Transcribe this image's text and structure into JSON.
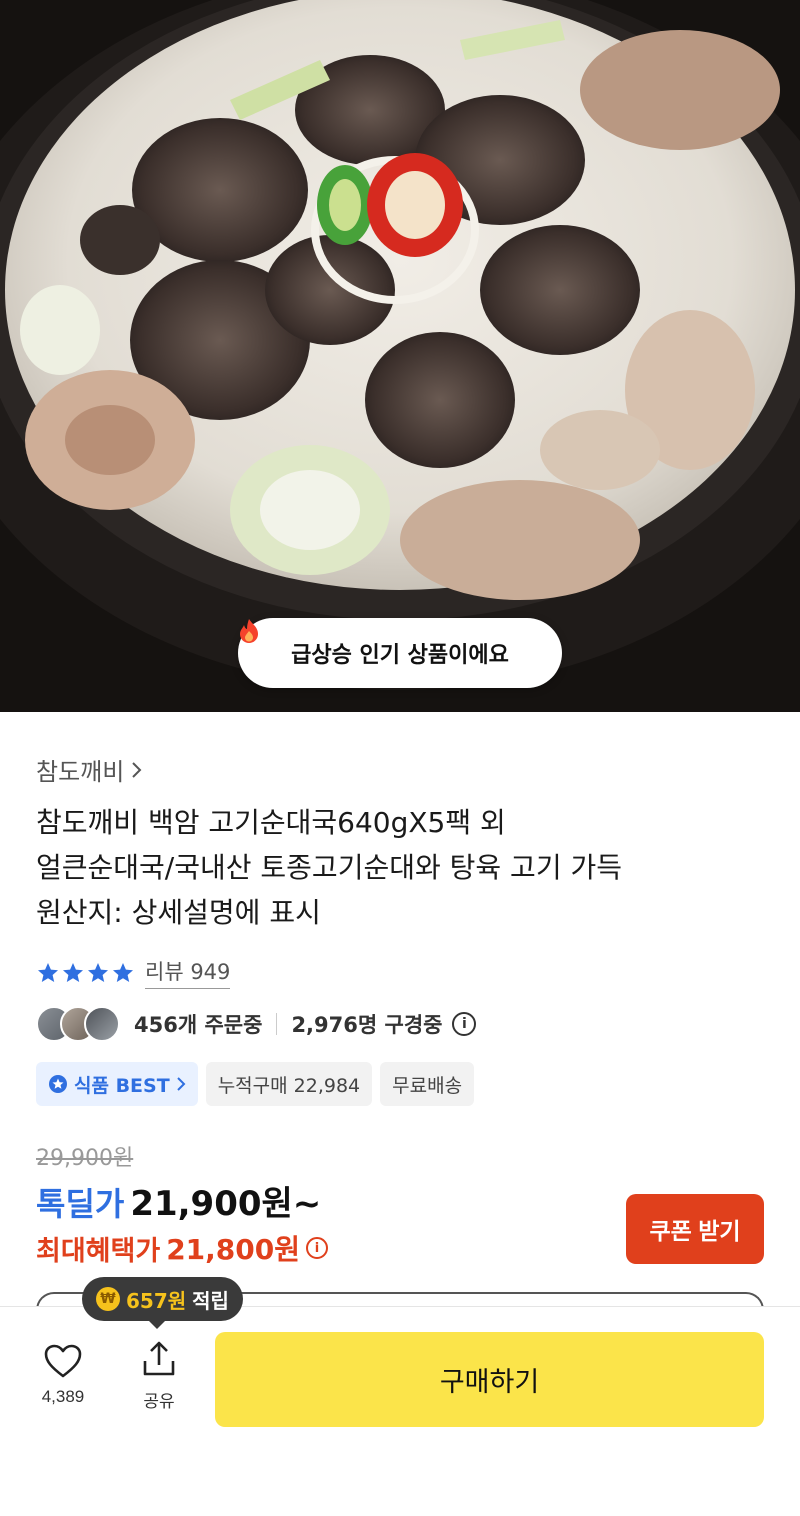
{
  "hero": {
    "image_desc_icon": "food-photo",
    "badge_text": "급상승 인기 상품이에요"
  },
  "product": {
    "seller": "참도깨비",
    "title_lines": [
      "참도깨비 백암 고기순대국640gX5팩 외",
      "얼큰순대국/국내산 토종고기순대와 탕육 고기 가득",
      "원산지: 상세설명에 표시"
    ],
    "review_label": "리뷰 949",
    "rating_stars": 4,
    "order_count": "456개 주문중",
    "viewer_count": "2,976명 구경중",
    "chips": {
      "best": "식품 BEST",
      "cumulative": "누적구매 22,984",
      "shipping": "무료배송"
    },
    "original_price": "29,900원",
    "deal_label": "톡딜가",
    "deal_price": "21,900원~",
    "max_label": "최대혜택가",
    "max_price": "21,800원",
    "coupon_button": "쿠폰 받기"
  },
  "bottom": {
    "like_count": "4,389",
    "share_label": "공유",
    "buy_button": "구매하기",
    "points_tooltip_amount": "657원",
    "points_tooltip_suffix": "적립"
  },
  "colors": {
    "accent_blue": "#2f6fe0",
    "accent_red": "#e0401c",
    "buy_yellow": "#fbe44a"
  }
}
